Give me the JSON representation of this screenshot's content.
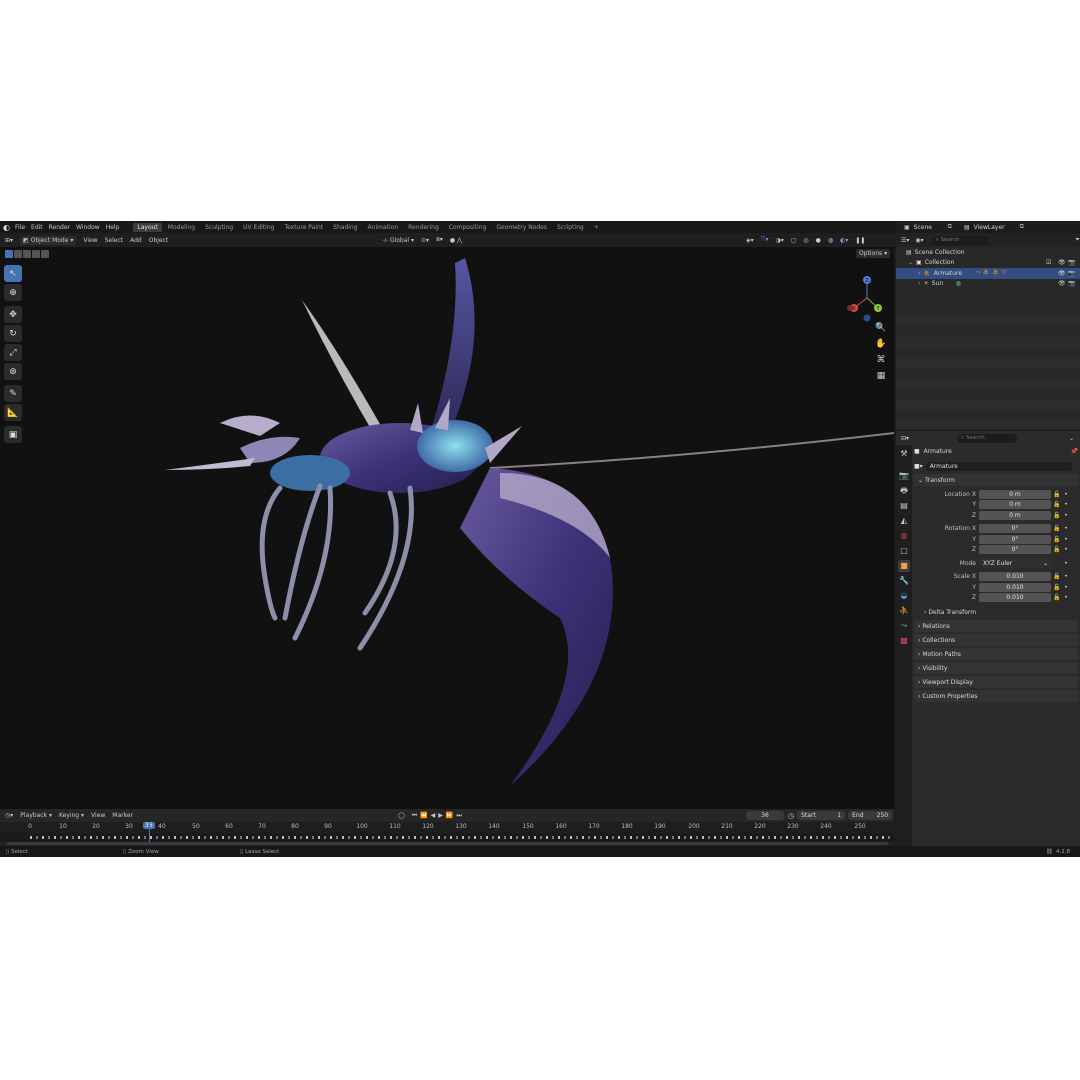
{
  "topbar": {
    "menus": [
      "File",
      "Edit",
      "Render",
      "Window",
      "Help"
    ],
    "workspaces": [
      "Layout",
      "Modeling",
      "Sculpting",
      "UV Editing",
      "Texture Paint",
      "Shading",
      "Animation",
      "Rendering",
      "Compositing",
      "Geometry Nodes",
      "Scripting"
    ],
    "active_workspace": "Layout",
    "add_tab": "+",
    "scene_name": "Scene",
    "view_layer": "ViewLayer"
  },
  "viewport_header": {
    "mode": "Object Mode",
    "menus": [
      "View",
      "Select",
      "Add",
      "Object"
    ],
    "orientation": "Global",
    "options": "Options"
  },
  "gizmo": {
    "x": "X",
    "y": "Y",
    "z": "Z"
  },
  "timeline": {
    "menus": [
      "Playback",
      "Keying",
      "View",
      "Marker"
    ],
    "current_frame": "36",
    "start_label": "Start",
    "start": "1",
    "end_label": "End",
    "end": "250",
    "ticks": [
      "0",
      "10",
      "20",
      "30",
      "40",
      "50",
      "60",
      "70",
      "80",
      "90",
      "100",
      "110",
      "120",
      "130",
      "140",
      "150",
      "160",
      "170",
      "180",
      "190",
      "200",
      "210",
      "220",
      "230",
      "240",
      "250"
    ]
  },
  "status": {
    "select": "Select",
    "zoom": "Zoom View",
    "lasso": "Lasso Select",
    "version": "4.2.8"
  },
  "outliner": {
    "search_placeholder": "Search",
    "scene_collection": "Scene Collection",
    "collection": "Collection",
    "armature": "Armature",
    "sun": "Sun"
  },
  "properties": {
    "search_placeholder": "Search",
    "object_name": "Armature",
    "data_name": "Armature",
    "transform_label": "Transform",
    "location_label": "Location X",
    "loc_x": "0 m",
    "loc_y": "0 m",
    "loc_z": "0 m",
    "rotation_label": "Rotation X",
    "rot_x": "0°",
    "rot_y": "0°",
    "rot_z": "0°",
    "mode_label": "Mode",
    "mode_value": "XYZ Euler",
    "scale_label": "Scale X",
    "scale_x": "0.010",
    "scale_y": "0.010",
    "scale_z": "0.010",
    "y_label": "Y",
    "z_label": "Z",
    "delta": "Delta Transform",
    "panels": [
      "Relations",
      "Collections",
      "Motion Paths",
      "Visibility",
      "Viewport Display",
      "Custom Properties"
    ]
  },
  "colors": {
    "accent": "#4772b3",
    "selected_row": "#334d80",
    "timeline_marker": "#4772b3"
  }
}
